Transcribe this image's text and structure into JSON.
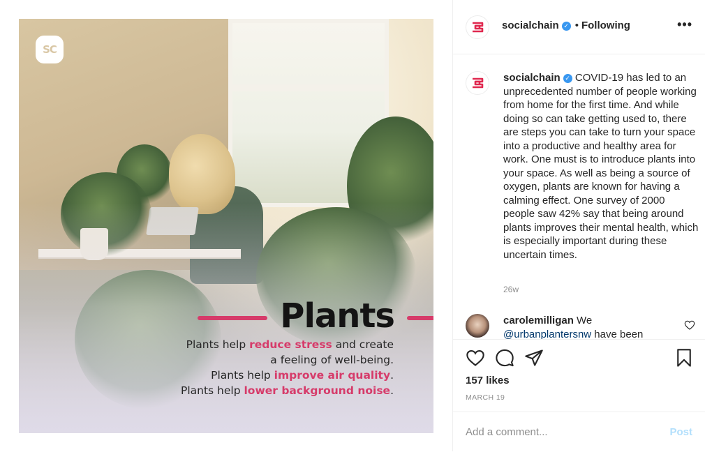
{
  "post_image": {
    "brand_logo_text": "SC",
    "headline": "Plants",
    "lines": [
      {
        "pre": "Plants help ",
        "highlight": "reduce stress",
        "post": " and create"
      },
      {
        "pre": "a feeling of well-being.",
        "highlight": "",
        "post": ""
      },
      {
        "pre": "Plants help ",
        "highlight": "improve air quality",
        "post": "."
      },
      {
        "pre": "Plants help ",
        "highlight": "lower background noise",
        "post": "."
      }
    ],
    "highlight_color": "#d63b6a"
  },
  "header": {
    "username": "socialchain",
    "dot": "•",
    "follow_status": "Following",
    "more_icon": "•••"
  },
  "caption": {
    "username": "socialchain",
    "text": "COVID-19 has led to an unprecedented number of people working from home for the first time. And while doing so can take getting used to, there are steps you can take to turn your space into a productive and healthy area for work. One must is to introduce plants into your space. As well as being a source of oxygen, plants are known for having a calming effect. One survey of 2000 people saw 42% say that being around plants improves their mental health, which is especially important during these uncertain times.",
    "time": "26w"
  },
  "comment": {
    "username": "carolemilligan",
    "text": "We",
    "mention": "@urbanplantersnw",
    "text_after": " have been"
  },
  "actions": {
    "likes": "157 likes",
    "date": "MARCH 19"
  },
  "add_comment": {
    "placeholder": "Add a comment...",
    "post_label": "Post"
  },
  "colors": {
    "brand_red": "#e0284f",
    "verified_blue": "#3897f0",
    "post_disabled": "#b2dffc"
  }
}
